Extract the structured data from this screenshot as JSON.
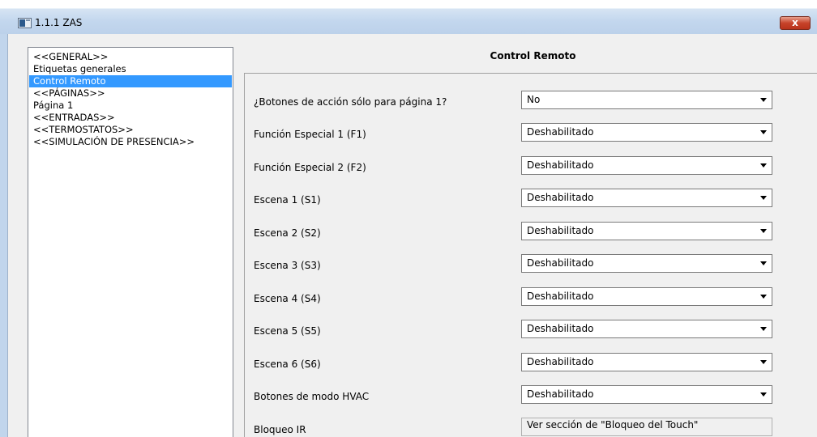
{
  "window": {
    "title": "1.1.1 ZAS",
    "close_label": "x"
  },
  "sidebar": {
    "items": [
      {
        "label": "<<GENERAL>>",
        "selected": false
      },
      {
        "label": "Etiquetas generales",
        "selected": false
      },
      {
        "label": "Control Remoto",
        "selected": true
      },
      {
        "label": "<<PÁGINAS>>",
        "selected": false
      },
      {
        "label": "Página 1",
        "selected": false
      },
      {
        "label": "<<ENTRADAS>>",
        "selected": false
      },
      {
        "label": "<<TERMOSTATOS>>",
        "selected": false
      },
      {
        "label": "<<SIMULACIÓN DE PRESENCIA>>",
        "selected": false
      }
    ]
  },
  "main": {
    "header": "Control Remoto",
    "rows": [
      {
        "label": "¿Botones de acción sólo para página 1?",
        "value": "No"
      },
      {
        "label": "Función Especial 1 (F1)",
        "value": "Deshabilitado"
      },
      {
        "label": "Función Especial 2 (F2)",
        "value": "Deshabilitado"
      },
      {
        "label": "Escena 1 (S1)",
        "value": "Deshabilitado"
      },
      {
        "label": "Escena 2 (S2)",
        "value": "Deshabilitado"
      },
      {
        "label": "Escena 3 (S3)",
        "value": "Deshabilitado"
      },
      {
        "label": "Escena 4 (S4)",
        "value": "Deshabilitado"
      },
      {
        "label": "Escena 5 (S5)",
        "value": "Deshabilitado"
      },
      {
        "label": "Escena 6 (S6)",
        "value": "Deshabilitado"
      },
      {
        "label": "Botones de modo HVAC",
        "value": "Deshabilitado"
      }
    ],
    "readonly_row": {
      "label": "Bloqueo IR",
      "value": "Ver sección de \"Bloqueo del Touch\""
    }
  },
  "colors": {
    "selection": "#3399ff",
    "titlebar": "#c3d7ee",
    "close_button": "#c7432a"
  }
}
